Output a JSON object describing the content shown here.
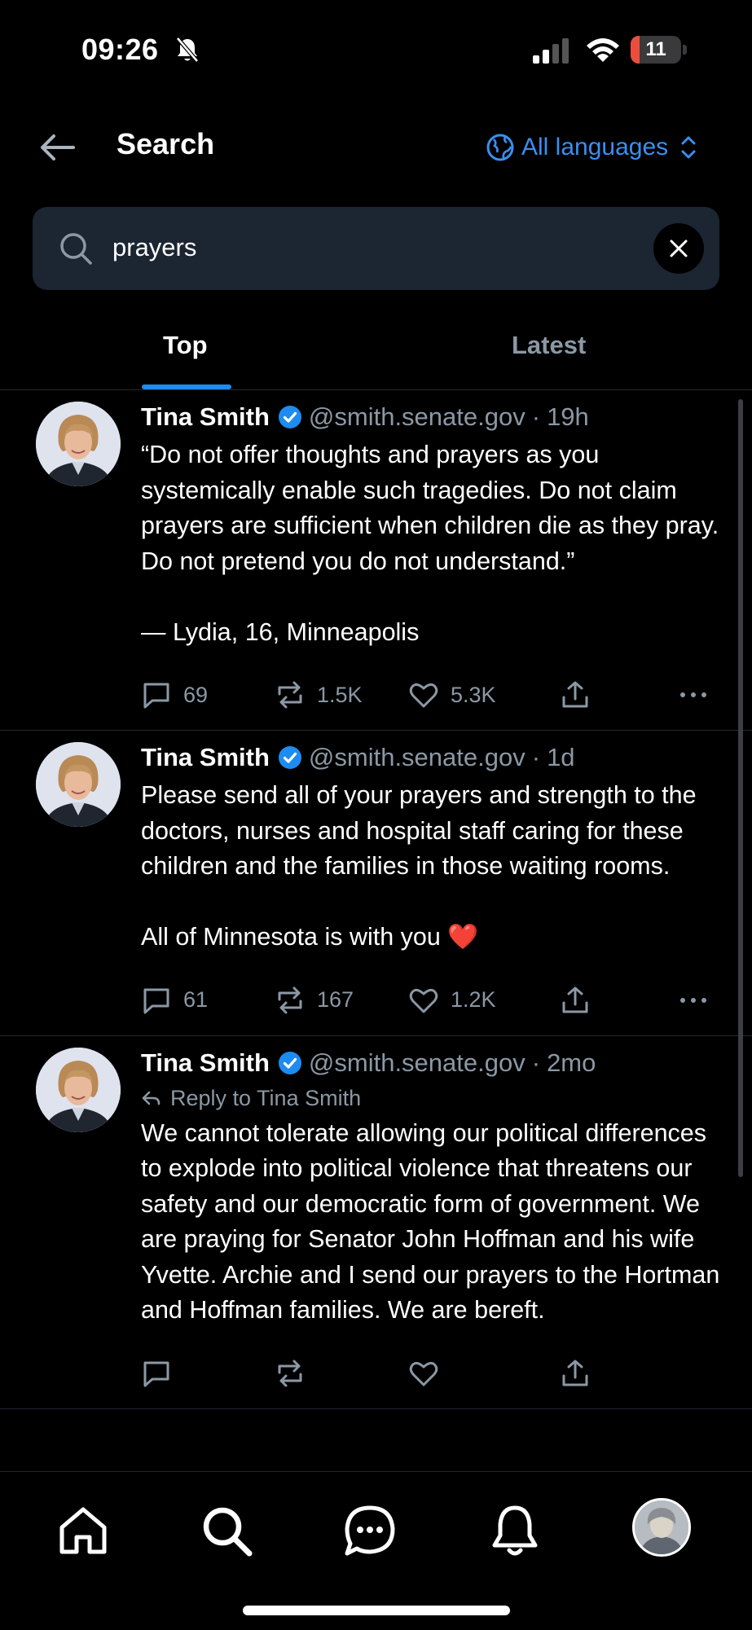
{
  "status_bar": {
    "time": "09:26",
    "battery": "11",
    "battery_level": 0.11
  },
  "header": {
    "title": "Search",
    "language_label": "All languages"
  },
  "search": {
    "value": "prayers"
  },
  "tabs": [
    {
      "label": "Top",
      "active": true
    },
    {
      "label": "Latest",
      "active": false
    }
  ],
  "posts": [
    {
      "author": "Tina Smith",
      "handle": "@smith.senate.gov",
      "time": "19h",
      "reply_to": "",
      "paragraphs": [
        "“Do not offer thoughts and prayers as you systemically enable such tragedies. Do not claim prayers are sufficient when children die as they pray. Do not pretend you do not understand.”",
        "— Lydia, 16, Minneapolis"
      ],
      "replies": "69",
      "reposts": "1.5K",
      "likes": "5.3K"
    },
    {
      "author": "Tina Smith",
      "handle": "@smith.senate.gov",
      "time": "1d",
      "reply_to": "",
      "paragraphs": [
        "Please send all of your prayers and strength to the doctors, nurses and hospital staff caring for these children and the families in those waiting rooms.",
        "All of Minnesota is with you ❤️"
      ],
      "replies": "61",
      "reposts": "167",
      "likes": "1.2K"
    },
    {
      "author": "Tina Smith",
      "handle": "@smith.senate.gov",
      "time": "2mo",
      "reply_to": "Reply to Tina Smith",
      "paragraphs": [
        "We cannot tolerate allowing our political differences to explode into political violence that threatens our safety and our democratic form of government.  We are praying for Senator John Hoffman and his wife Yvette.  Archie and I send our prayers to the Hortman and Hoffman families.  We are bereft."
      ],
      "replies": "",
      "reposts": "",
      "likes": ""
    }
  ],
  "colors": {
    "accent": "#1d8cf0",
    "link": "#3a8ff2",
    "muted": "#8b98a5",
    "search_bg": "#1c2532",
    "battery_red": "#eb4e3d"
  },
  "icons": [
    "back-arrow-icon",
    "globe-icon",
    "chevron-updown-icon",
    "search-icon",
    "close-icon",
    "verified-icon",
    "reply-icon",
    "repost-icon",
    "heart-icon",
    "share-icon",
    "more-icon",
    "home-icon",
    "messages-icon",
    "notifications-icon"
  ]
}
